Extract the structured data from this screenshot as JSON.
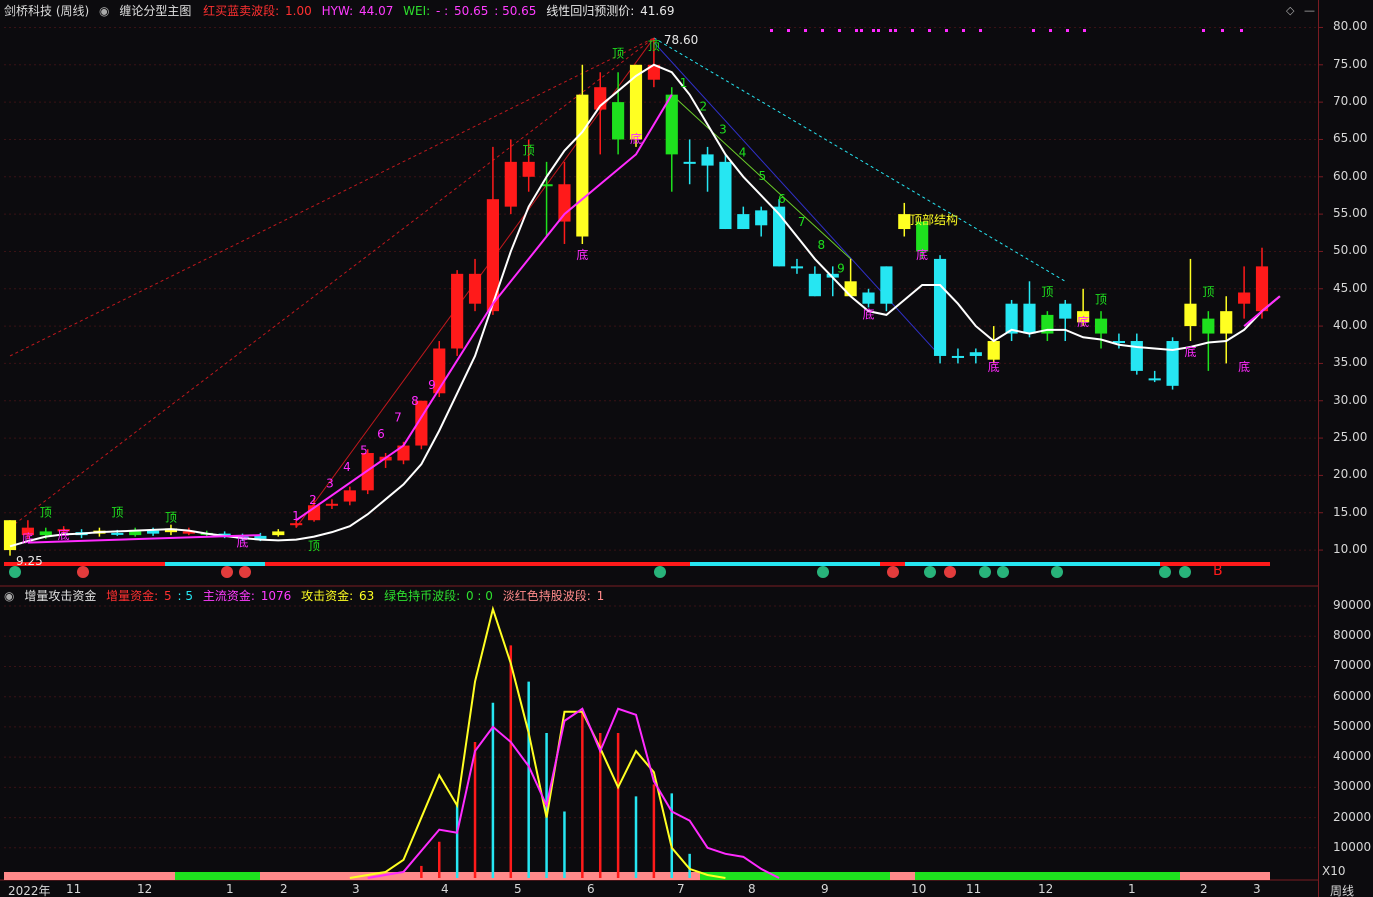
{
  "top_bar": {
    "stock_name": "剑桥科技 (周线)",
    "main_indicator": "缠论分型主图",
    "red_buy_blue_sell_label": "红买蓝卖波段:",
    "red_buy_blue_sell_value": "1.00",
    "hyw_label": "HYW:",
    "hyw_value": "44.07",
    "wei_label": "WEI:",
    "wei_value": "- :",
    "wei_value2": "50.65",
    "wei_value3": ": 50.65",
    "forecast_label": "线性回归预测价:",
    "forecast_value": "41.69",
    "icons": [
      "diamond-icon",
      "minimize-icon"
    ]
  },
  "sub_bar": {
    "indicator_name": "增量攻击资金",
    "incr_label": "增量资金:",
    "incr_value": "5",
    "incr_value2": ": 5",
    "main_label": "主流资金:",
    "main_value": "1076",
    "attack_label": "攻击资金:",
    "attack_value": "63",
    "green_label": "绿色持币波段:",
    "green_value": "0 : 0",
    "pink_label": "淡红色持股波段:",
    "pink_value": "1"
  },
  "colors": {
    "up": "#ff1a1a",
    "down_cyan": "#26e6f2",
    "yellow": "#ffff22",
    "green": "#1ee01e",
    "magenta": "#ff2bff",
    "white": "#ffffff",
    "grid": "#3a1215"
  },
  "annotations": {
    "high_price": "78.60",
    "low_price": "9.25",
    "top_structure": "顶部结构",
    "top": "顶",
    "bottom": "底",
    "b_marker": "B",
    "x10": "X10"
  },
  "chart_data": [
    {
      "type": "candlestick",
      "title": "缠论分型主图",
      "ylim": [
        8,
        81
      ],
      "y_ticks": [
        "80.00",
        "75.00",
        "70.00",
        "65.00",
        "60.00",
        "55.00",
        "50.00",
        "45.00",
        "40.00",
        "35.00",
        "30.00",
        "25.00",
        "20.00",
        "15.00",
        "10.00"
      ],
      "candles": [
        {
          "o": 10,
          "c": 14,
          "h": 14,
          "l": 9.25,
          "col": "yellow"
        },
        {
          "o": 12,
          "c": 13,
          "h": 14,
          "l": 11.5,
          "col": "red"
        },
        {
          "o": 12.5,
          "c": 12,
          "h": 13,
          "l": 11.5,
          "col": "green"
        },
        {
          "o": 12.5,
          "c": 12.8,
          "h": 13.2,
          "l": 12,
          "col": "red"
        },
        {
          "o": 12,
          "c": 12.4,
          "h": 12.8,
          "l": 11.6,
          "col": "cyan"
        },
        {
          "o": 12.2,
          "c": 12.6,
          "h": 13,
          "l": 11.8,
          "col": "yellow"
        },
        {
          "o": 12.3,
          "c": 12.1,
          "h": 12.7,
          "l": 11.9,
          "col": "cyan"
        },
        {
          "o": 12,
          "c": 12.5,
          "h": 13,
          "l": 11.8,
          "col": "green"
        },
        {
          "o": 12.2,
          "c": 12.6,
          "h": 13,
          "l": 11.9,
          "col": "cyan"
        },
        {
          "o": 12.4,
          "c": 12.9,
          "h": 13.4,
          "l": 12,
          "col": "yellow"
        },
        {
          "o": 12.5,
          "c": 12.2,
          "h": 13,
          "l": 12,
          "col": "red"
        },
        {
          "o": 12.2,
          "c": 12.3,
          "h": 12.6,
          "l": 11.8,
          "col": "green"
        },
        {
          "o": 11.9,
          "c": 12.2,
          "h": 12.5,
          "l": 11.6,
          "col": "cyan"
        },
        {
          "o": 11.8,
          "c": 11.6,
          "h": 12.2,
          "l": 11.2,
          "col": "cyan"
        },
        {
          "o": 11.5,
          "c": 11.9,
          "h": 12.3,
          "l": 11.2,
          "col": "cyan"
        },
        {
          "o": 12,
          "c": 12.5,
          "h": 12.8,
          "l": 11.8,
          "col": "yellow"
        },
        {
          "o": 13.4,
          "c": 13.6,
          "h": 14,
          "l": 13,
          "col": "red"
        },
        {
          "o": 14,
          "c": 16,
          "h": 17,
          "l": 13.8,
          "col": "red"
        },
        {
          "o": 16,
          "c": 16.2,
          "h": 16.8,
          "l": 15.5,
          "col": "red"
        },
        {
          "o": 16.5,
          "c": 18,
          "h": 18.5,
          "l": 16,
          "col": "red"
        },
        {
          "o": 18,
          "c": 23,
          "h": 23.5,
          "l": 17.5,
          "col": "red"
        },
        {
          "o": 22,
          "c": 22.5,
          "h": 23,
          "l": 21,
          "col": "red"
        },
        {
          "o": 22,
          "c": 24,
          "h": 24.5,
          "l": 21.5,
          "col": "red"
        },
        {
          "o": 24,
          "c": 30,
          "h": 30,
          "l": 23.5,
          "col": "red"
        },
        {
          "o": 31,
          "c": 37,
          "h": 38,
          "l": 30.5,
          "col": "red"
        },
        {
          "o": 37,
          "c": 47,
          "h": 47.5,
          "l": 36,
          "col": "red"
        },
        {
          "o": 43,
          "c": 47,
          "h": 49,
          "l": 42,
          "col": "red"
        },
        {
          "o": 42,
          "c": 57,
          "h": 64,
          "l": 41.5,
          "col": "red"
        },
        {
          "o": 56,
          "c": 62,
          "h": 65,
          "l": 55,
          "col": "red"
        },
        {
          "o": 60,
          "c": 62,
          "h": 65,
          "l": 58,
          "col": "red"
        },
        {
          "o": 59,
          "c": 59,
          "h": 62,
          "l": 52,
          "col": "green"
        },
        {
          "o": 59,
          "c": 54,
          "h": 62,
          "l": 51,
          "col": "red"
        },
        {
          "o": 52,
          "c": 71,
          "h": 75,
          "l": 51,
          "col": "yellow"
        },
        {
          "o": 69,
          "c": 72,
          "h": 74,
          "l": 63,
          "col": "red"
        },
        {
          "o": 70,
          "c": 65,
          "h": 74,
          "l": 63,
          "col": "green"
        },
        {
          "o": 65,
          "c": 75,
          "h": 75,
          "l": 64,
          "col": "yellow"
        },
        {
          "o": 73,
          "c": 75,
          "h": 78.6,
          "l": 72,
          "col": "red"
        },
        {
          "o": 71,
          "c": 63,
          "h": 72,
          "l": 58,
          "col": "green"
        },
        {
          "o": 62,
          "c": 62,
          "h": 65,
          "l": 59,
          "col": "cyan"
        },
        {
          "o": 63,
          "c": 61.5,
          "h": 64,
          "l": 58,
          "col": "cyan"
        },
        {
          "o": 62,
          "c": 53,
          "h": 63,
          "l": 53,
          "col": "cyan"
        },
        {
          "o": 53,
          "c": 55,
          "h": 56,
          "l": 53,
          "col": "cyan"
        },
        {
          "o": 55.5,
          "c": 53.5,
          "h": 56,
          "l": 52,
          "col": "cyan"
        },
        {
          "o": 56,
          "c": 48,
          "h": 57,
          "l": 48,
          "col": "cyan"
        },
        {
          "o": 48,
          "c": 48,
          "h": 49,
          "l": 47,
          "col": "cyan"
        },
        {
          "o": 47,
          "c": 44,
          "h": 48,
          "l": 44,
          "col": "cyan"
        },
        {
          "o": 47,
          "c": 46.5,
          "h": 48,
          "l": 44,
          "col": "cyan"
        },
        {
          "o": 46,
          "c": 44,
          "h": 49,
          "l": 44,
          "col": "yellow"
        },
        {
          "o": 44.5,
          "c": 43,
          "h": 45,
          "l": 42.5,
          "col": "cyan"
        },
        {
          "o": 43,
          "c": 48,
          "h": 48,
          "l": 42,
          "col": "cyan"
        },
        {
          "o": 53,
          "c": 55,
          "h": 56.5,
          "l": 52,
          "col": "yellow"
        },
        {
          "o": 54,
          "c": 50,
          "h": 54,
          "l": 49,
          "col": "green"
        },
        {
          "o": 49,
          "c": 36,
          "h": 49.5,
          "l": 35,
          "col": "cyan"
        },
        {
          "o": 36,
          "c": 36,
          "h": 37,
          "l": 35,
          "col": "cyan"
        },
        {
          "o": 36,
          "c": 36.5,
          "h": 37,
          "l": 35,
          "col": "cyan"
        },
        {
          "o": 38,
          "c": 35.5,
          "h": 40,
          "l": 35,
          "col": "yellow"
        },
        {
          "o": 39,
          "c": 43,
          "h": 43.5,
          "l": 38,
          "col": "cyan"
        },
        {
          "o": 39,
          "c": 43,
          "h": 46,
          "l": 38.5,
          "col": "cyan"
        },
        {
          "o": 41.5,
          "c": 39,
          "h": 42,
          "l": 38,
          "col": "green"
        },
        {
          "o": 43,
          "c": 41,
          "h": 43.5,
          "l": 38,
          "col": "cyan"
        },
        {
          "o": 42,
          "c": 40.5,
          "h": 45,
          "l": 40,
          "col": "yellow"
        },
        {
          "o": 41,
          "c": 39,
          "h": 42,
          "l": 37,
          "col": "green"
        },
        {
          "o": 38,
          "c": 38,
          "h": 39,
          "l": 37,
          "col": "cyan"
        },
        {
          "o": 38,
          "c": 34,
          "h": 39,
          "l": 33.5,
          "col": "cyan"
        },
        {
          "o": 33,
          "c": 33,
          "h": 34,
          "l": 32.5,
          "col": "cyan"
        },
        {
          "o": 32,
          "c": 38,
          "h": 38.5,
          "l": 31.5,
          "col": "cyan"
        },
        {
          "o": 40,
          "c": 43,
          "h": 49,
          "l": 38,
          "col": "yellow"
        },
        {
          "o": 39,
          "c": 41,
          "h": 42,
          "l": 34,
          "col": "green"
        },
        {
          "o": 39,
          "c": 42,
          "h": 44,
          "l": 35,
          "col": "yellow"
        },
        {
          "o": 43,
          "c": 44.5,
          "h": 48,
          "l": 41,
          "col": "red"
        },
        {
          "o": 42,
          "c": 48,
          "h": 50.5,
          "l": 41,
          "col": "red"
        }
      ],
      "ma_white": [
        10.5,
        11.2,
        11.8,
        12.1,
        12.2,
        12.4,
        12.5,
        12.6,
        12.7,
        12.8,
        12.6,
        12.2,
        11.9,
        11.6,
        11.4,
        11.3,
        11.4,
        11.8,
        12.4,
        13.2,
        14.8,
        16.8,
        18.8,
        21.5,
        26,
        31,
        36,
        43,
        50,
        56,
        60,
        63.5,
        66,
        69.5,
        71.5,
        73.5,
        75,
        74,
        71,
        67,
        63,
        60,
        57.5,
        55,
        52,
        49,
        46.5,
        44,
        42,
        41.5,
        43.5,
        45.5,
        45.5,
        43,
        40,
        38,
        39.5,
        39,
        39.5,
        39.5,
        38.5,
        38.2,
        37.5,
        37.2,
        37,
        36.8,
        37.2,
        37.8,
        38,
        39.5,
        42,
        44
      ]
    },
    {
      "type": "line+bar",
      "title": "增量攻击资金",
      "ylim": [
        0,
        92000
      ],
      "y_ticks": [
        "90000",
        "80000",
        "70000",
        "60000",
        "50000",
        "40000",
        "30000",
        "20000",
        "10000"
      ],
      "x_ticks": [
        "2022年",
        "11",
        "12",
        "1",
        "2",
        "3",
        "4",
        "5",
        "6",
        "7",
        "8",
        "9",
        "10",
        "11",
        "12",
        "1",
        "2",
        "3",
        "周线"
      ]
    }
  ]
}
